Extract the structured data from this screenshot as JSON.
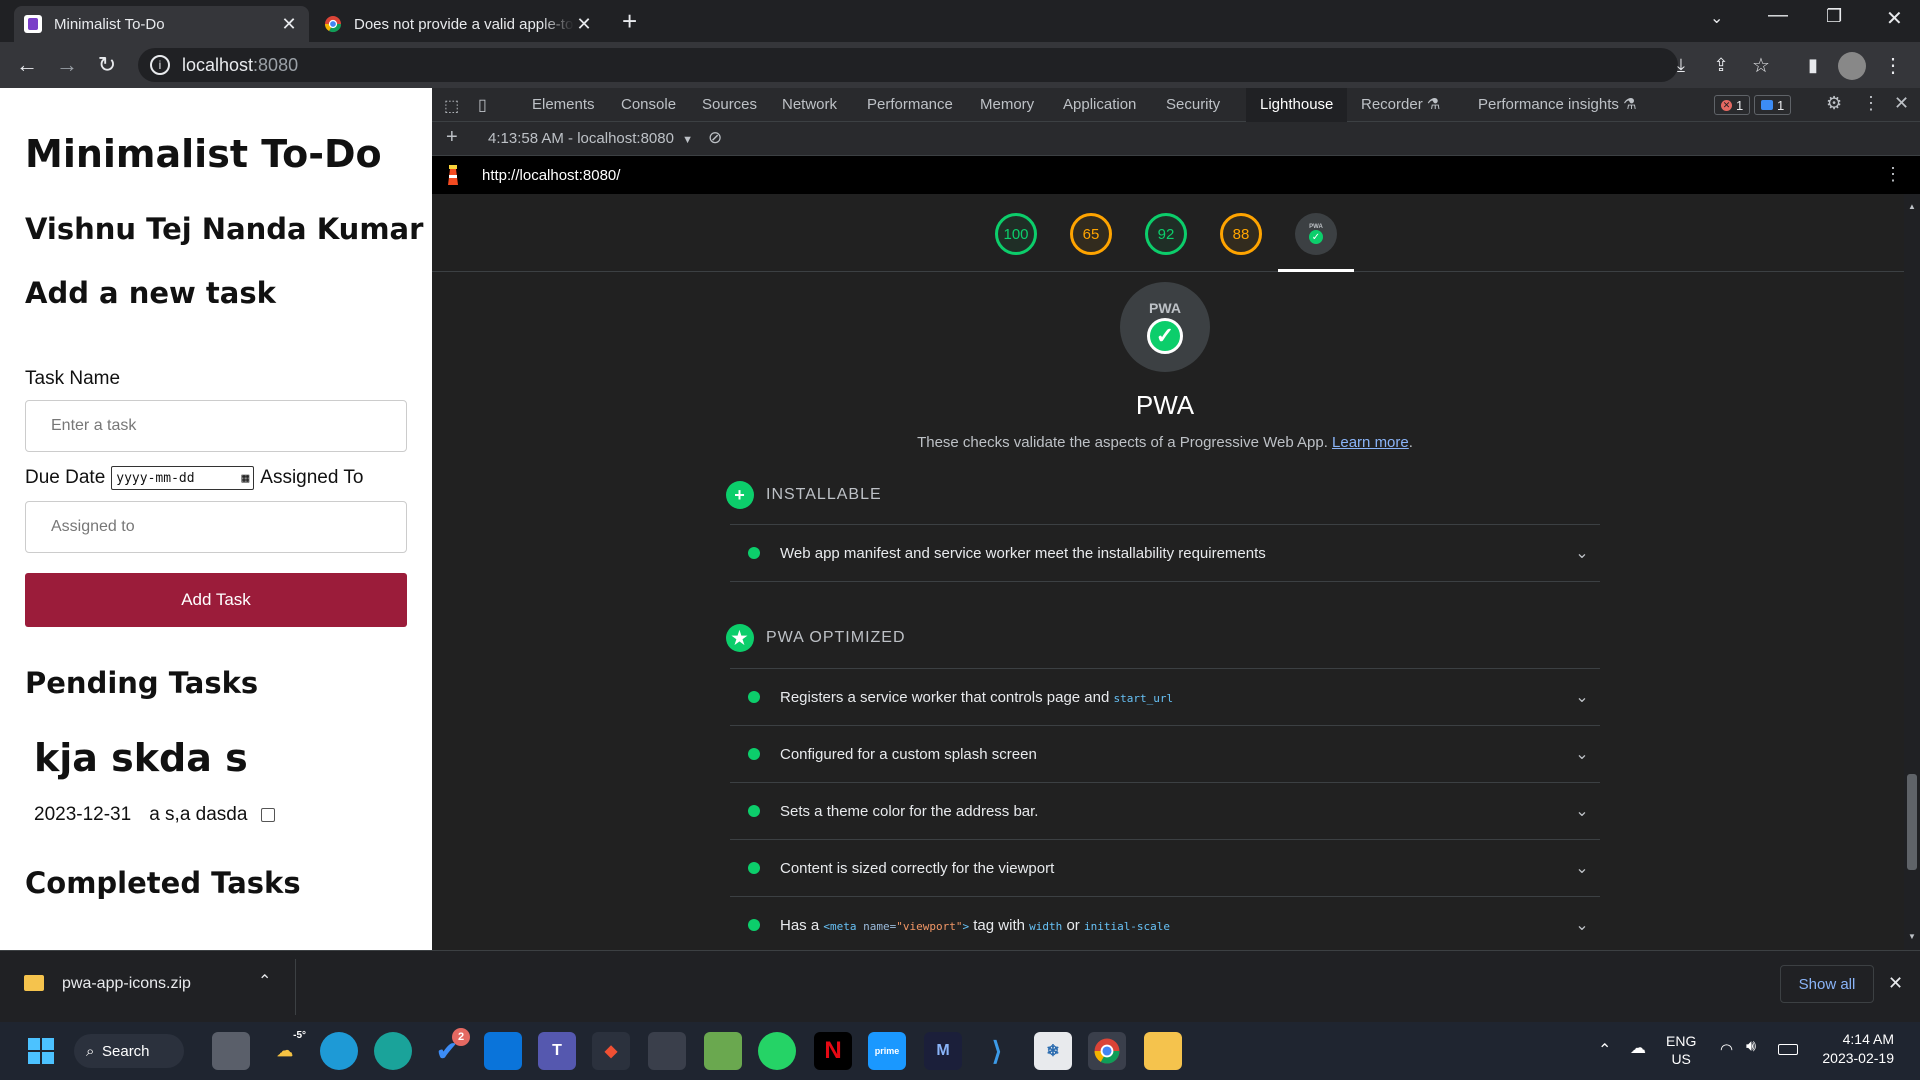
{
  "browser": {
    "tabs": [
      {
        "title": "Minimalist To-Do",
        "active": true
      },
      {
        "title": "Does not provide a valid apple-touch-icon",
        "active": false
      }
    ],
    "url_host": "localhost",
    "url_port": ":8080"
  },
  "app": {
    "title": "Minimalist To-Do",
    "author": "Vishnu Tej Nanda Kumar",
    "add_heading": "Add a new task",
    "task_name_label": "Task Name",
    "task_name_placeholder": "Enter a task",
    "due_date_label": "Due Date",
    "date_placeholder": "yyyy-mm-dd",
    "assigned_label": "Assigned To",
    "assigned_placeholder": "Assigned to",
    "add_button": "Add Task",
    "pending_heading": "Pending Tasks",
    "completed_heading": "Completed Tasks",
    "pending_tasks": [
      {
        "name": "kja skda s",
        "date": "2023-12-31",
        "assignee": "a s,a dasda",
        "done": false
      }
    ]
  },
  "devtools": {
    "tabs": [
      "Elements",
      "Console",
      "Sources",
      "Network",
      "Performance",
      "Memory",
      "Application",
      "Security",
      "Lighthouse",
      "Recorder",
      "Performance insights"
    ],
    "active_tab": "Lighthouse",
    "error_count": "1",
    "message_count": "1",
    "report_time": "4:13:58 AM - localhost:8080",
    "report_url": "http://localhost:8080/",
    "scores": [
      "100",
      "65",
      "92",
      "88"
    ],
    "pwa_badge_text": "PWA",
    "category_title": "PWA",
    "category_description": "These checks validate the aspects of a Progressive Web App.",
    "learn_more": "Learn more",
    "group_installable": "INSTALLABLE",
    "group_optimized": "PWA OPTIMIZED",
    "audit_installable": "Web app manifest and service worker meet the installability requirements",
    "audit_sw_prefix": "Registers a service worker that controls page and",
    "audit_sw_code": "start_url",
    "audit_splash": "Configured for a custom splash screen",
    "audit_theme": "Sets a theme color for the address bar.",
    "audit_viewport": "Content is sized correctly for the viewport",
    "audit_meta_prefix": "Has a",
    "audit_meta_tag": "<meta",
    "audit_meta_attr": "name=",
    "audit_meta_val": "\"viewport\"",
    "audit_meta_close": ">",
    "audit_meta_mid": "tag with",
    "audit_meta_width": "width",
    "audit_meta_or": "or",
    "audit_meta_scale": "initial-scale"
  },
  "downloads": {
    "file": "pwa-app-icons.zip",
    "show_all": "Show all"
  },
  "taskbar": {
    "search": "Search",
    "weather": "-5°",
    "badge": "2",
    "lang": "ENG",
    "region": "US",
    "time": "4:14 AM",
    "date": "2023-02-19"
  },
  "colors": {
    "add_button": "#9b1c3a",
    "score_green": "#0cce6b",
    "score_orange": "#ffa400",
    "link": "#8ab4f8"
  }
}
